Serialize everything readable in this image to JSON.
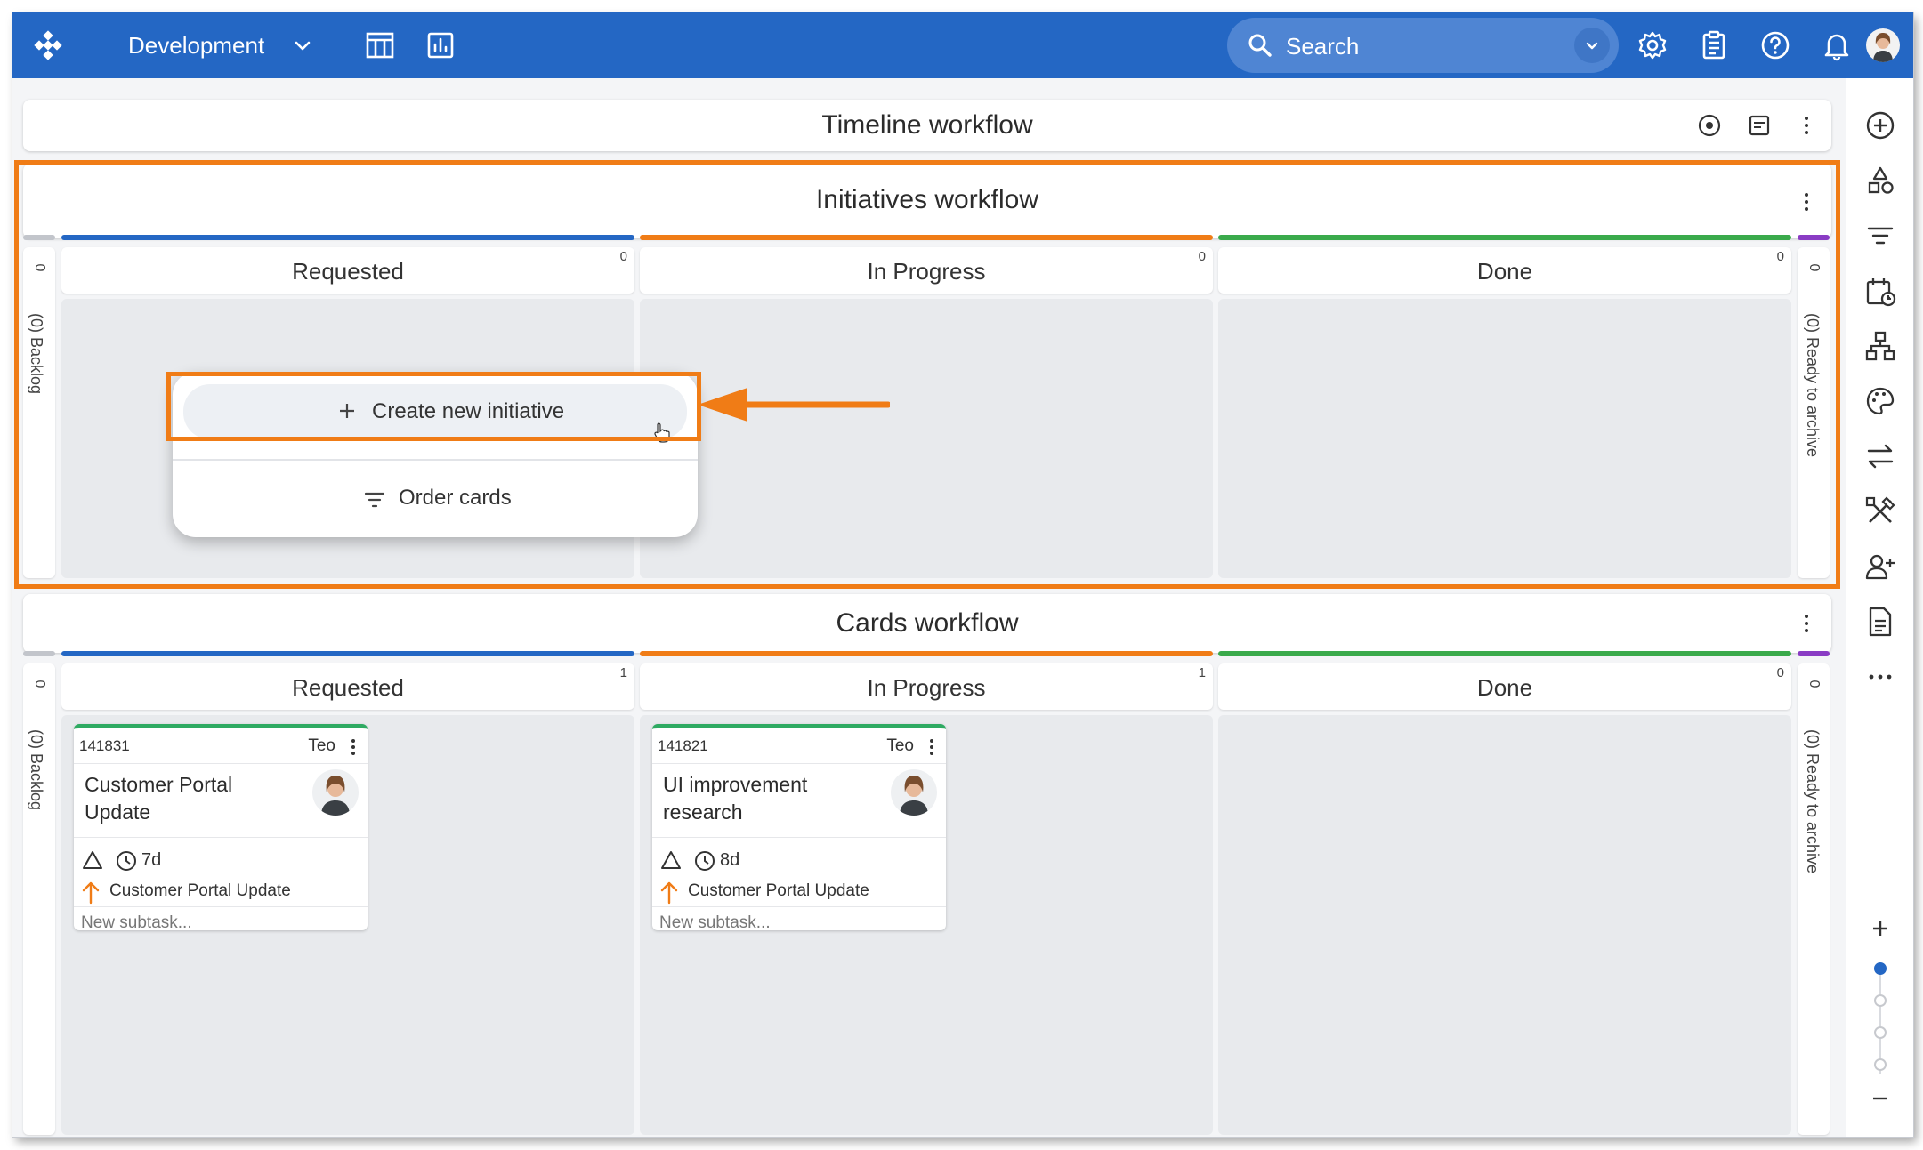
{
  "topbar": {
    "board_name": "Development",
    "search_placeholder": "Search"
  },
  "colors": {
    "brand": "#2467c4",
    "requested": "#2467c4",
    "in_progress": "#f07c16",
    "done": "#3aaa4b",
    "archive": "#8a3cc4",
    "highlight": "#f07c16",
    "card_top": "#2eaa62"
  },
  "timeline": {
    "title": "Timeline workflow"
  },
  "initiatives": {
    "title": "Initiatives workflow",
    "backlog_count": "0",
    "backlog_label": "(0) Backlog",
    "archive_count": "0",
    "archive_label": "(0) Ready to archive",
    "lanes": [
      {
        "title": "Requested",
        "count": "0"
      },
      {
        "title": "In Progress",
        "count": "0"
      },
      {
        "title": "Done",
        "count": "0"
      }
    ]
  },
  "popup": {
    "create_label": "Create new initiative",
    "order_label": "Order cards"
  },
  "cards_workflow": {
    "title": "Cards workflow",
    "backlog_count": "0",
    "backlog_label": "(0) Backlog",
    "archive_count": "0",
    "archive_label": "(0) Ready to archive",
    "lanes": [
      {
        "title": "Requested",
        "count": "1"
      },
      {
        "title": "In Progress",
        "count": "1"
      },
      {
        "title": "Done",
        "count": "0"
      }
    ],
    "cards": [
      {
        "id": "141831",
        "owner": "Teo",
        "title": "Customer Portal Update",
        "days": "7d",
        "parent": "Customer Portal Update",
        "subtask_placeholder": "New subtask..."
      },
      {
        "id": "141821",
        "owner": "Teo",
        "title": "UI improvement research",
        "days": "8d",
        "parent": "Customer Portal Update",
        "subtask_placeholder": "New subtask..."
      }
    ]
  },
  "icons": {
    "topbar": [
      "logo-icon",
      "chevron-down-icon",
      "table-view-icon",
      "analytics-icon",
      "search-icon",
      "settings-icon",
      "clipboard-icon",
      "help-icon",
      "bell-icon",
      "avatar"
    ],
    "rail": [
      "add-circle-icon",
      "shapes-icon",
      "filter-icon",
      "calendar-clock-icon",
      "hierarchy-icon",
      "palette-icon",
      "swap-icon",
      "tools-icon",
      "add-user-icon",
      "document-icon",
      "more-icon",
      "zoom-in-icon",
      "zoom-out-icon"
    ]
  }
}
